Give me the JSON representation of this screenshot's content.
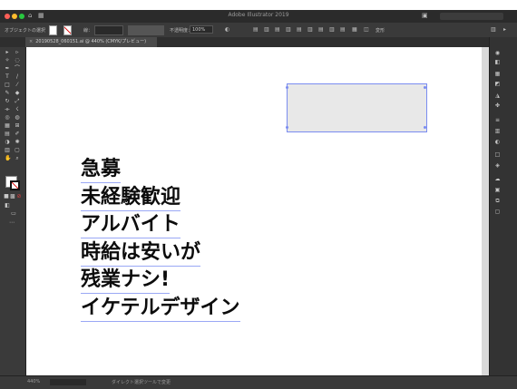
{
  "window": {
    "title": "Adobe Illustrator 2019"
  },
  "control_bar": {
    "selection_label": "オブジェクトの選択",
    "stroke_label": "線：",
    "opacity_label": "不透明度：",
    "opacity_value": "100%",
    "transform_label": "変形"
  },
  "document_tab": {
    "label": "20190528_060151.ai @ 440% (CMYK/プレビュー)"
  },
  "canvas": {
    "text_lines": [
      "急募",
      "未経験歓迎",
      "アルバイト",
      "時給は安いが",
      "残業ナシ!",
      "イケテルデザイン"
    ]
  },
  "status_bar": {
    "zoom": "440%",
    "tool_hint": "ダイレクト選択ツールで変更"
  },
  "colors": {
    "selection": "#7a8cf0",
    "rect_fill": "#e8e8e8",
    "ui_dark": "#3a3a3a"
  }
}
